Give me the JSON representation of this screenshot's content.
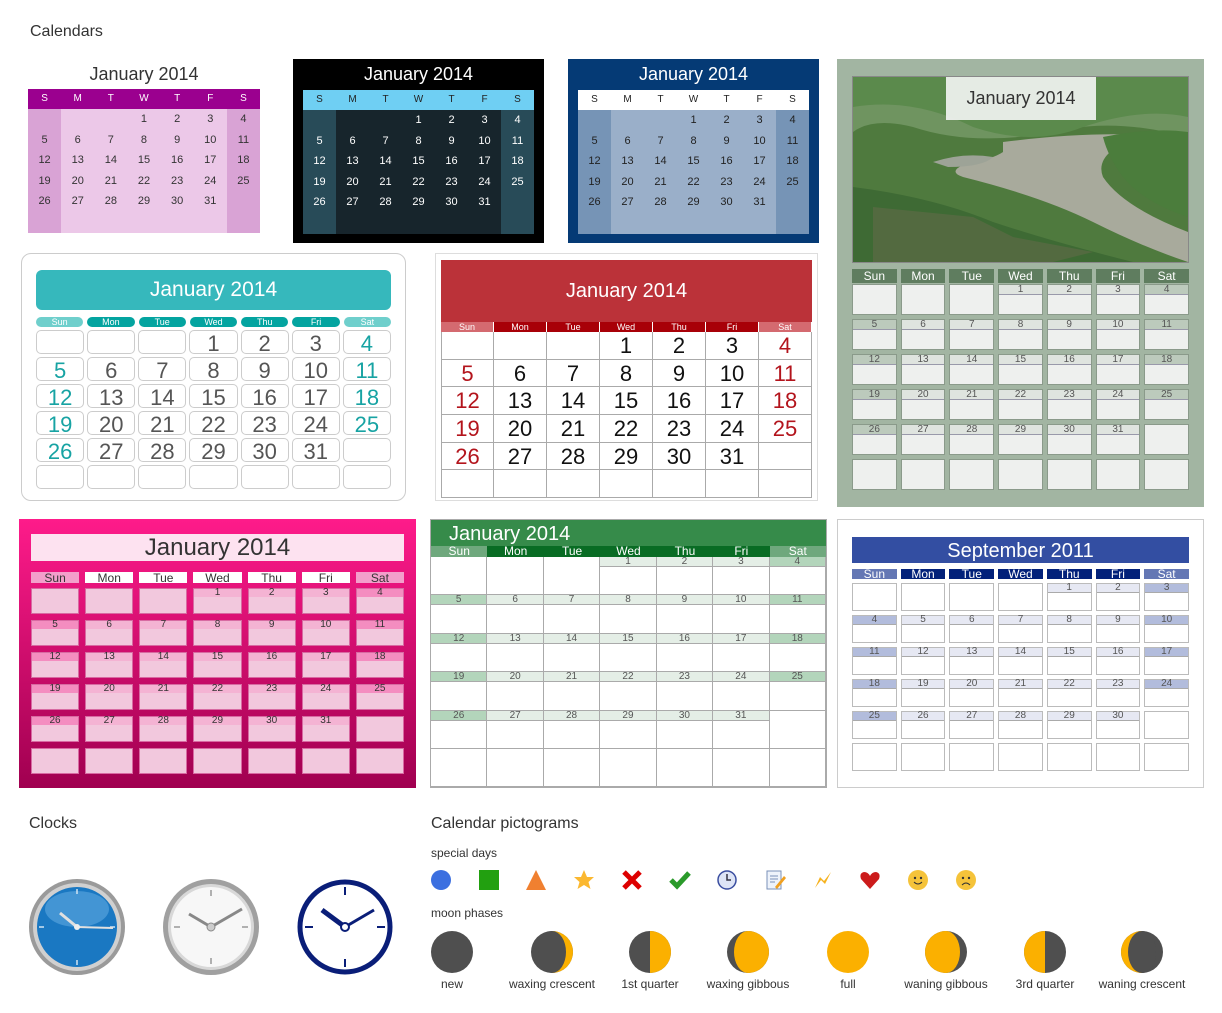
{
  "sections": {
    "calendars": "Calendars",
    "clocks": "Clocks",
    "pictograms": "Calendar pictograms",
    "special_days": "special days",
    "moon_phases": "moon phases"
  },
  "weekdays_short": [
    "S",
    "M",
    "T",
    "W",
    "T",
    "F",
    "S"
  ],
  "weekdays_abbr": [
    "Sun",
    "Mon",
    "Tue",
    "Wed",
    "Thu",
    "Fri",
    "Sat"
  ],
  "calendars": [
    {
      "id": "cal1",
      "style": "lilac",
      "title": "January 2014",
      "first_weekday": 3,
      "days": 31,
      "colors": {
        "header": "#9b008f",
        "body": "#ecc8e8",
        "weekend": "#d9a3d5"
      }
    },
    {
      "id": "cal2",
      "style": "black",
      "title": "January 2014",
      "first_weekday": 3,
      "days": 31,
      "colors": {
        "frame": "#000000",
        "header": "#6fcff3",
        "body": "#17252c",
        "weekend": "#284b58"
      }
    },
    {
      "id": "cal3",
      "style": "navy",
      "title": "January 2014",
      "first_weekday": 3,
      "days": 31,
      "colors": {
        "frame": "#053a75",
        "header": "#ffffff",
        "body": "#9aafc9",
        "weekend": "#7694b6"
      }
    },
    {
      "id": "cal4",
      "style": "photo",
      "title": "January 2014",
      "first_weekday": 3,
      "days": 31,
      "colors": {
        "frame": "#a2b5a2",
        "header": "#5f7d5f"
      }
    },
    {
      "id": "cal5",
      "style": "teal",
      "title": "January 2014",
      "first_weekday": 3,
      "days": 31,
      "colors": {
        "title": "#36b8bc",
        "header": "#04a4a0",
        "weekend_text": "#17a3a3"
      }
    },
    {
      "id": "cal6",
      "style": "red",
      "title": "January 2014",
      "first_weekday": 3,
      "days": 31,
      "colors": {
        "title": "#bb3239",
        "header": "#a80008",
        "weekend_text": "#b3141c"
      }
    },
    {
      "id": "cal7",
      "style": "pink",
      "title": "January 2014",
      "first_weekday": 3,
      "days": 31,
      "colors": {
        "frame": "#fe1b8a",
        "cell": "#f2c8dd"
      }
    },
    {
      "id": "cal8",
      "style": "green",
      "title": "January 2014",
      "first_weekday": 3,
      "days": 31,
      "colors": {
        "title": "#368b4a",
        "header": "#096c24",
        "weekend": "#b3d5bb"
      }
    },
    {
      "id": "cal9",
      "style": "blue",
      "title": "September 2011",
      "first_weekday": 4,
      "days": 30,
      "colors": {
        "title": "#334ea2",
        "header": "#02217a",
        "weekend": "#b2bcdc"
      }
    }
  ],
  "clocks": [
    {
      "name": "blue-glossy-clock",
      "face": "#1a78c2"
    },
    {
      "name": "silver-clock",
      "face": "#f5f5f5"
    },
    {
      "name": "navy-outline-clock",
      "face": "#ffffff"
    }
  ],
  "special_days": [
    {
      "icon": "blue-circle-icon"
    },
    {
      "icon": "green-square-icon"
    },
    {
      "icon": "orange-triangle-icon"
    },
    {
      "icon": "star-icon"
    },
    {
      "icon": "red-x-icon"
    },
    {
      "icon": "checkmark-icon"
    },
    {
      "icon": "clock-icon"
    },
    {
      "icon": "note-pencil-icon"
    },
    {
      "icon": "lightning-icon"
    },
    {
      "icon": "heart-icon"
    },
    {
      "icon": "smiley-icon"
    },
    {
      "icon": "sad-face-icon"
    }
  ],
  "moon_phases": [
    {
      "label": "new",
      "lit": "none"
    },
    {
      "label": "waxing crescent",
      "lit": "right-crescent"
    },
    {
      "label": "1st quarter",
      "lit": "right-half"
    },
    {
      "label": "waxing gibbous",
      "lit": "right-gibbous"
    },
    {
      "label": "full",
      "lit": "full"
    },
    {
      "label": "waning gibbous",
      "lit": "left-gibbous"
    },
    {
      "label": "3rd quarter",
      "lit": "left-half"
    },
    {
      "label": "waning crescent",
      "lit": "left-crescent"
    }
  ]
}
